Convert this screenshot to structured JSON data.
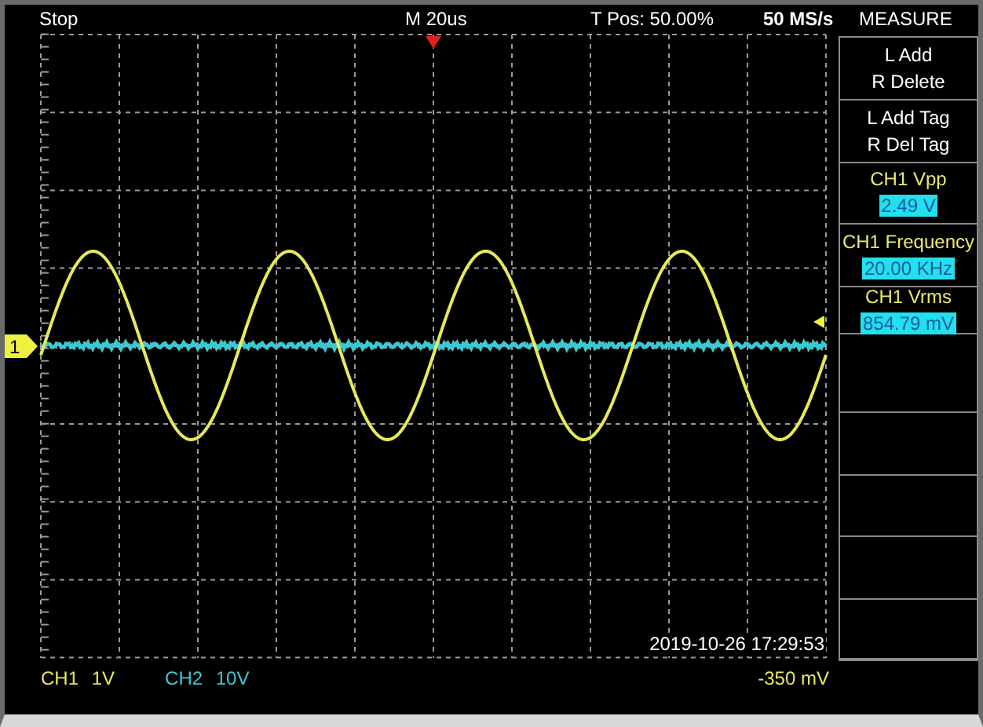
{
  "status_bar": {
    "state": "Stop",
    "timebase": "M 20us",
    "trigger_position": "T Pos: 50.00%",
    "sample_rate": "50 MS/s"
  },
  "plot": {
    "channel_marker": "1",
    "timestamp": "2019-10-26 17:29:53"
  },
  "measure_panel": {
    "title": "MEASURE",
    "buttons": [
      {
        "lines": [
          "L Add",
          "R Delete"
        ]
      },
      {
        "lines": [
          "L Add Tag",
          "R Del Tag"
        ]
      }
    ],
    "measurements": [
      {
        "label": "CH1 Vpp",
        "value": "2.49 V"
      },
      {
        "label": "CH1 Frequency",
        "value": "20.00 KHz"
      },
      {
        "label": "CH1 Vrms",
        "value": "854.79 mV"
      }
    ]
  },
  "channels": [
    {
      "name": "CH1",
      "scale": "1V",
      "color": "#e8e85a"
    },
    {
      "name": "CH2",
      "scale": "10V",
      "color": "#3cc8d0"
    }
  ],
  "trigger_level": "-350 mV"
}
